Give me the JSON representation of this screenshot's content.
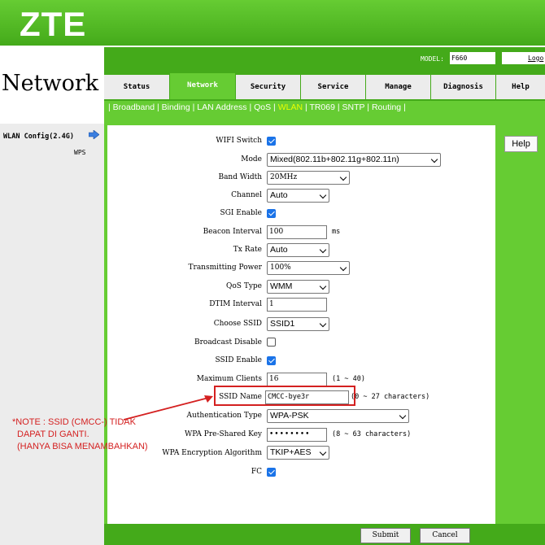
{
  "brand": {
    "logo": "ZTE",
    "page_title": "Network"
  },
  "header": {
    "model_label": "MODEL:",
    "model_value": "F660",
    "logout": "Logo"
  },
  "tabs": [
    {
      "label": "Status",
      "active": false
    },
    {
      "label": "Network",
      "active": true
    },
    {
      "label": "Security",
      "active": false
    },
    {
      "label": "Service",
      "active": false
    },
    {
      "label": "Manage",
      "active": false
    },
    {
      "label": "Diagnosis",
      "active": false
    },
    {
      "label": "Help",
      "active": false
    }
  ],
  "subnav": [
    "Broadband",
    "Binding",
    "LAN Address",
    "QoS",
    "WLAN",
    "TR069",
    "SNTP",
    "Routing"
  ],
  "subnav_active": "WLAN",
  "sidebar": {
    "wlan_config": "WLAN Config(2.4G)",
    "wps": "WPS"
  },
  "help_button": "Help",
  "form": {
    "wifi_switch": {
      "label": "WIFI Switch",
      "checked": true
    },
    "mode": {
      "label": "Mode",
      "value": "Mixed(802.11b+802.11g+802.11n)"
    },
    "band_width": {
      "label": "Band Width",
      "value": "20MHz"
    },
    "channel": {
      "label": "Channel",
      "value": "Auto"
    },
    "sgi_enable": {
      "label": "SGI Enable",
      "checked": true
    },
    "beacon_interval": {
      "label": "Beacon Interval",
      "value": "100",
      "unit": "ms"
    },
    "tx_rate": {
      "label": "Tx Rate",
      "value": "Auto"
    },
    "transmitting_power": {
      "label": "Transmitting Power",
      "value": "100%"
    },
    "qos_type": {
      "label": "QoS Type",
      "value": "WMM"
    },
    "dtim_interval": {
      "label": "DTIM Interval",
      "value": "1"
    },
    "choose_ssid": {
      "label": "Choose SSID",
      "value": "SSID1"
    },
    "broadcast_disable": {
      "label": "Broadcast Disable",
      "checked": false
    },
    "ssid_enable": {
      "label": "SSID Enable",
      "checked": true
    },
    "maximum_clients": {
      "label": "Maximum Clients",
      "value": "16",
      "hint": "(1 ~ 40)"
    },
    "ssid_name": {
      "label": "SSID Name",
      "value": "CMCC-bye3r",
      "hint": "(0 ~ 27 characters)"
    },
    "authentication_type": {
      "label": "Authentication Type",
      "value": "WPA-PSK"
    },
    "wpa_key": {
      "label": "WPA Pre-Shared Key",
      "value": "••••••••",
      "hint": "(8 ~ 63 characters)"
    },
    "wpa_encryption": {
      "label": "WPA Encryption Algorithm",
      "value": "TKIP+AES"
    },
    "fc": {
      "label": "FC",
      "checked": true
    }
  },
  "buttons": {
    "submit": "Submit",
    "cancel": "Cancel"
  },
  "annotation": {
    "line1": "*NOTE : SSID (CMCC-) TIDAK",
    "line2": "DAPAT DI GANTI.",
    "line3": "(HANYA BISA MENAMBAHKAN)"
  },
  "colors": {
    "brand_green": "#44aa1a",
    "light_green": "#66cc33",
    "annotation_red": "#d42020",
    "checkbox_blue": "#1a73e8"
  }
}
